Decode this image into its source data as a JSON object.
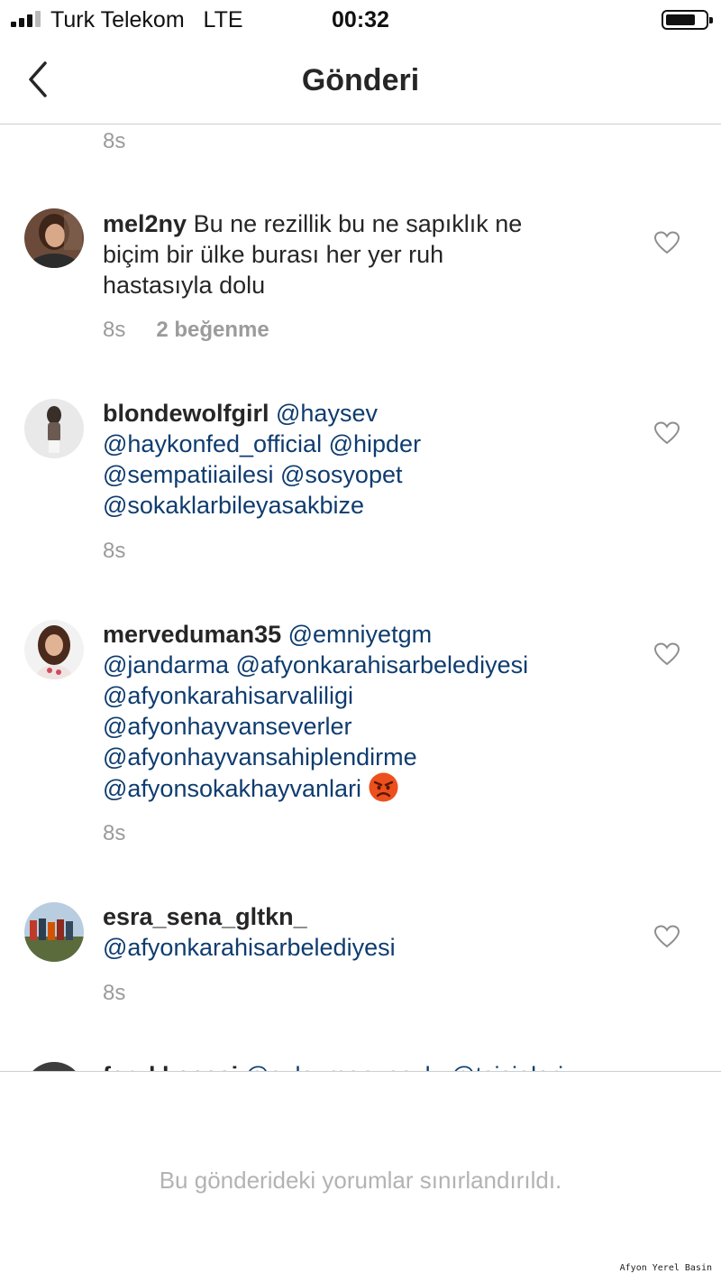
{
  "status_bar": {
    "carrier": "Turk Telekom",
    "network": "LTE",
    "time": "00:32"
  },
  "header": {
    "title": "Gönderi"
  },
  "top_time": "8s",
  "comments": [
    {
      "username": "mel2ny",
      "text_lines": [
        "Bu ne rezillik bu ne sapıklık ne",
        "biçim bir ülke burası her yer ruh",
        "hastasıyla dolu"
      ],
      "time": "8s",
      "likes": "2 beğenme"
    },
    {
      "username": "blondewolfgirl",
      "mentions": [
        "@haysev",
        "@haykonfed_official",
        "@hipder",
        "@sempatiiailesi",
        "@sosyopet",
        "@sokaklarbileyasakbize"
      ],
      "time": "8s"
    },
    {
      "username": "merveduman35",
      "mentions": [
        "@emniyetgm",
        "@jandarma",
        "@afyonkarahisarbelediyesi",
        "@afyonkarahisarvaliligi",
        "@afyonhayvanseverler",
        "@afyonhayvansahiplendirme",
        "@afyonsokakhayvanlari"
      ],
      "emoji": "angry-face-emoji",
      "time": "8s"
    },
    {
      "username": "esra_sena_gltkn_",
      "mentions": [
        "@afyonkarahisarbelediyesi"
      ],
      "time": "8s"
    },
    {
      "username": "farukkoeesi",
      "mentions": [
        "@suleyman_soylu",
        "@tsisieleri"
      ]
    }
  ],
  "footer": {
    "restricted_message": "Bu gönderideki yorumlar sınırlandırıldı."
  },
  "watermark": "Afyon Yerel Basin",
  "colors": {
    "mention": "#0e3c6f",
    "meta": "#9b9b9b",
    "text": "#262626",
    "restricted": "#b3b3b3"
  }
}
